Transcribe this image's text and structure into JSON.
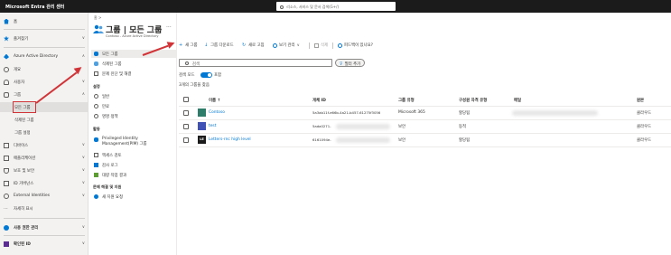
{
  "topbar": {
    "app_title": "Microsoft Entra 관리 센터",
    "search_placeholder": "리소스, 서비스 및 문서 검색(G+/)"
  },
  "leftnav": {
    "items": [
      {
        "label": "홈"
      },
      {
        "label": "즐겨찾기"
      },
      {
        "label": "Azure Active Directory"
      },
      {
        "label": "개요"
      },
      {
        "label": "사용자"
      },
      {
        "label": "그룹"
      },
      {
        "label": "모든 그룹"
      },
      {
        "label": "삭제된 그룹"
      },
      {
        "label": "그룹 설정"
      },
      {
        "label": "디바이스"
      },
      {
        "label": "애플리케이션"
      },
      {
        "label": "보호 및 보안"
      },
      {
        "label": "ID 거버넌스"
      },
      {
        "label": "External Identities"
      },
      {
        "label": "자세히 표시"
      },
      {
        "label": "사용 권한 관리"
      },
      {
        "label": "확인된 ID"
      }
    ]
  },
  "page": {
    "breadcrumb": "홈 >",
    "title": "그룹 | 모든 그룹",
    "subtitle": "Contoso - Azure Active Directory",
    "more": "···"
  },
  "panel": {
    "items": [
      {
        "label": "모든 그룹"
      },
      {
        "label": "삭제된 그룹"
      },
      {
        "label": "문제 진단 및 해결"
      }
    ],
    "section_settings": "설정",
    "settings_items": [
      {
        "label": "일반"
      },
      {
        "label": "만료"
      },
      {
        "label": "명명 정책"
      }
    ],
    "section_activity": "활동",
    "activity_items": [
      {
        "label": "Privileged Identity Management(PIM) 그룹"
      },
      {
        "label": "액세스 검토"
      },
      {
        "label": "감사 로그"
      },
      {
        "label": "대량 작업 결과"
      }
    ],
    "section_support": "문제 해결 및 지원",
    "support_items": [
      {
        "label": "새 지원 요청"
      }
    ]
  },
  "toolbar": {
    "new_group": "새 그룹",
    "download_groups": "그룹 다운로드",
    "refresh": "새로 고침",
    "manage_view": "보기 관리",
    "delete": "삭제",
    "feedback": "피드백이 있나요?"
  },
  "search": {
    "placeholder": "검색",
    "filter_label": "필터 추가",
    "mode_label": "검색 모드",
    "mode_value": "포함",
    "count_label": "3개의 그룹을 찾음"
  },
  "table": {
    "headers": [
      "이름 ↑",
      "개체 ID",
      "그룹 유형",
      "구성원 자격 유형",
      "메일",
      "원본"
    ],
    "rows": [
      {
        "initials": "",
        "avatar_color": "#2e7d6b",
        "name": "Contoso",
        "object_id": "5a3ab11f-e66b-4a21-b457-61275f3056",
        "group_type": "Microsoft 365",
        "membership": "할당됨",
        "source": "클라우드"
      },
      {
        "initials": "",
        "avatar_color": "#3f51b5",
        "name": "test",
        "object_id": "5ada0271-",
        "group_type": "보안",
        "membership": "동적",
        "source": "클라우드"
      },
      {
        "initials": "LE",
        "avatar_color": "#1b1b1b",
        "name": "Letters-rnc high level",
        "object_id": "6161094e-",
        "group_type": "보안",
        "membership": "할당됨",
        "source": "클라우드"
      }
    ]
  },
  "colors": {
    "accent": "#0078d4",
    "annotation": "#d13438",
    "topbar": "#1b1b1b"
  }
}
